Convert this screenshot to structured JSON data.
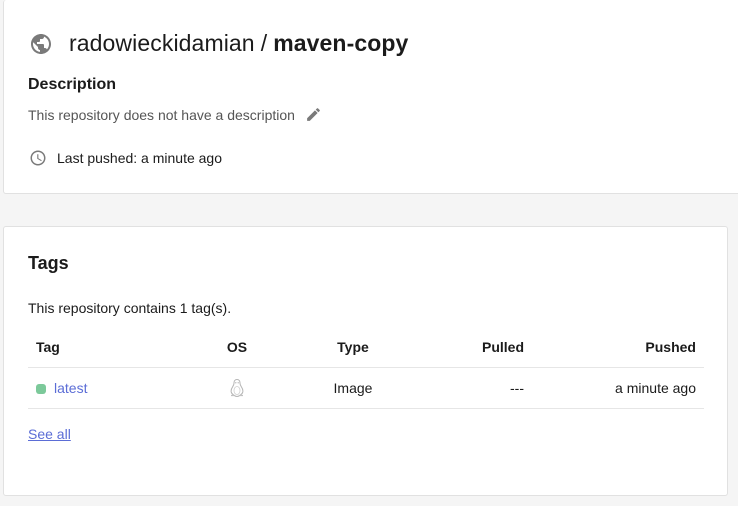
{
  "repo": {
    "namespace": "radowieckidamian",
    "separator": "/",
    "name": "maven-copy",
    "icon": "globe-icon",
    "description_label": "Description",
    "description_text": "This repository does not have a description",
    "last_pushed": "Last pushed: a minute ago"
  },
  "tags": {
    "title": "Tags",
    "count_text": "This repository contains 1 tag(s).",
    "columns": [
      "Tag",
      "OS",
      "Type",
      "Pulled",
      "Pushed"
    ],
    "rows": [
      {
        "tag": "latest",
        "os": "linux-icon",
        "type": "Image",
        "pulled": "---",
        "pushed": "a minute ago"
      }
    ],
    "see_all": "See all"
  },
  "colors": {
    "link": "#5b6dd6",
    "tag_dot": "#7cc99a",
    "icon_gray": "#7a7a7a"
  }
}
